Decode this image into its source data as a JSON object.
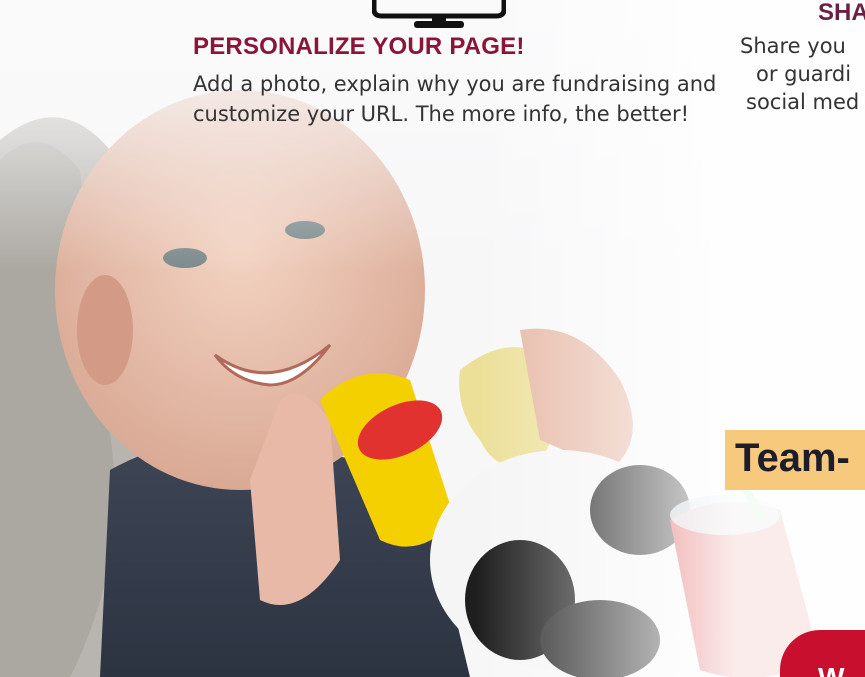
{
  "step": {
    "title": "PERSONALIZE YOUR PAGE!",
    "text": "Add a photo, explain why you are fundraising and customize your URL. The more info, the better!"
  },
  "share": {
    "title": "SHA",
    "lines": [
      "Share you",
      "or guardi",
      "social med"
    ]
  },
  "team_label": "Team-",
  "bottom_badge_text": "W",
  "icons": {
    "monitor": "monitor-icon"
  },
  "colors": {
    "title": "#8a1538",
    "share_title": "#6b1f45",
    "team_badge": "#f6c97c",
    "bottom_badge": "#c8102e"
  }
}
